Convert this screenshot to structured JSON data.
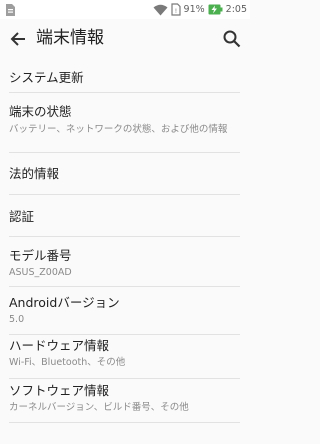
{
  "status_bar": {
    "battery_percent": "91%",
    "time": "2:05"
  },
  "app_bar": {
    "title": "端末情報"
  },
  "items": [
    {
      "title": "システム更新",
      "subtitle": ""
    },
    {
      "title": "端末の状態",
      "subtitle": "バッテリー、ネットワークの状態、および他の情報"
    },
    {
      "title": "法的情報",
      "subtitle": ""
    },
    {
      "title": "認証",
      "subtitle": ""
    },
    {
      "title": "モデル番号",
      "subtitle": "ASUS_Z00AD"
    },
    {
      "title": "Androidバージョン",
      "subtitle": "5.0"
    },
    {
      "title": "ハードウェア情報",
      "subtitle": "Wi-Fi、Bluetooth、その他"
    },
    {
      "title": "ソフトウェア情報",
      "subtitle": "カーネルバージョン、ビルド番号、その他"
    }
  ]
}
